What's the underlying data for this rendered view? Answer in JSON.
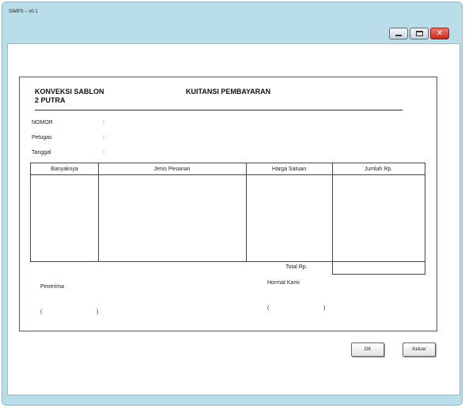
{
  "window": {
    "title": "SIMPS – v0.1",
    "controls": [
      "minimize-icon",
      "maximize-icon",
      "close-icon"
    ],
    "close_glyph": "✕"
  },
  "receipt": {
    "company_line1": "KONVEKSI SABLON",
    "company_line2": "2 PUTRA",
    "title": "KUITANSI PEMBAYARAN",
    "fields": [
      {
        "label": "NOMOR",
        "colon": ":"
      },
      {
        "label": "Petugas",
        "colon": ":"
      },
      {
        "label": "Tanggal",
        "colon": ":"
      }
    ],
    "table": {
      "headers": [
        "Banyaknya",
        "Jenis Pesanan",
        "Harga Satuan",
        "Jumlah Rp."
      ],
      "rows": []
    },
    "total_label": "Total Rp.",
    "total_value": "",
    "receiver_label": "Penerima",
    "receiver_open": "(",
    "receiver_close": ")",
    "signer_label": "Hormat Kami",
    "signer_open": "(",
    "signer_close": ")"
  },
  "buttons": {
    "ok": "OK",
    "exit": "Keluar"
  },
  "colors": {
    "window_bg": "#b9dde9",
    "close_button": "#d9382b"
  }
}
